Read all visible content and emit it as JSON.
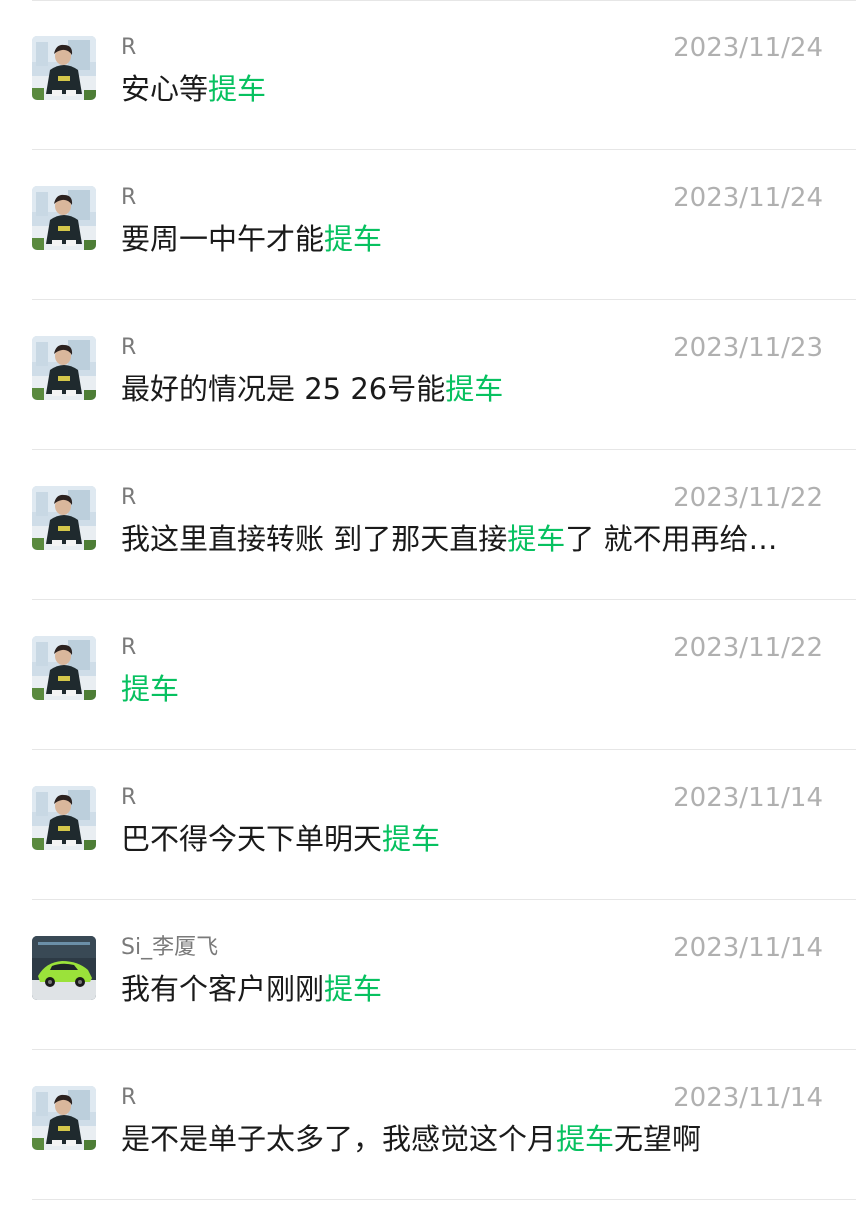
{
  "keyword": "提车",
  "colors": {
    "highlight": "#07c160",
    "sender": "#7a7a7a",
    "timestamp": "#b0b0b0",
    "message": "#1a1a1a",
    "divider": "#e6e6e6"
  },
  "results": [
    {
      "sender": "R",
      "avatar": "person-photo-icon",
      "date": "2023/11/24",
      "text_before": "安心等",
      "text_keyword": "提车",
      "text_after": ""
    },
    {
      "sender": "R",
      "avatar": "person-photo-icon",
      "date": "2023/11/24",
      "text_before": "要周一中午才能",
      "text_keyword": "提车",
      "text_after": ""
    },
    {
      "sender": "R",
      "avatar": "person-photo-icon",
      "date": "2023/11/23",
      "text_before": "最好的情况是 25 26号能",
      "text_keyword": "提车",
      "text_after": ""
    },
    {
      "sender": "R",
      "avatar": "person-photo-icon",
      "date": "2023/11/22",
      "text_before": "我这里直接转账 到了那天直接",
      "text_keyword": "提车",
      "text_after": "了 就不用再给…"
    },
    {
      "sender": "R",
      "avatar": "person-photo-icon",
      "date": "2023/11/22",
      "text_before": "",
      "text_keyword": "提车",
      "text_after": ""
    },
    {
      "sender": "R",
      "avatar": "person-photo-icon",
      "date": "2023/11/14",
      "text_before": "巴不得今天下单明天",
      "text_keyword": "提车",
      "text_after": ""
    },
    {
      "sender": "Si_李厦飞",
      "avatar": "green-car-photo-icon",
      "date": "2023/11/14",
      "text_before": "我有个客户刚刚",
      "text_keyword": "提车",
      "text_after": ""
    },
    {
      "sender": "R",
      "avatar": "person-photo-icon",
      "date": "2023/11/14",
      "text_before": "是不是单子太多了，我感觉这个月",
      "text_keyword": "提车",
      "text_after": "无望啊"
    }
  ]
}
